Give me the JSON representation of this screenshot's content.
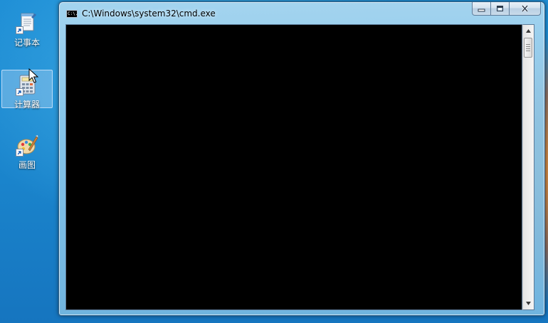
{
  "desktop": {
    "icons": [
      {
        "label": "记事本",
        "icon": "notepad-icon"
      },
      {
        "label": "计算器",
        "icon": "calculator-icon",
        "selected": true
      },
      {
        "label": "画图",
        "icon": "paint-icon"
      }
    ]
  },
  "window": {
    "title": "C:\\Windows\\system32\\cmd.exe",
    "app_icon_text": "C:\\.",
    "console_text": ""
  },
  "colors": {
    "desktop_blue": "#1a84cc",
    "console_background": "#000000",
    "sunset_orange": "#e65a0a"
  }
}
